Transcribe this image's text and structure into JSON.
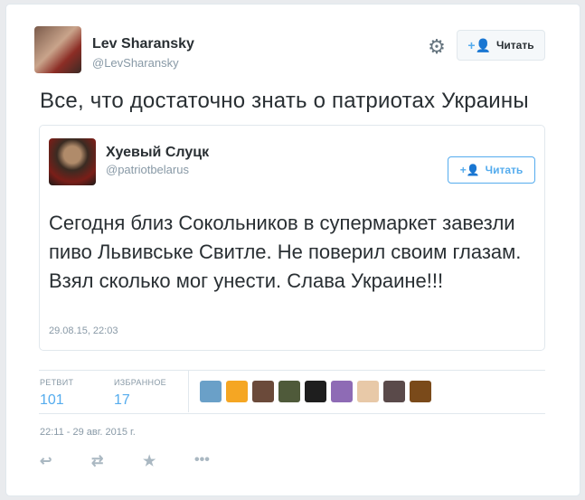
{
  "author": {
    "name": "Lev Sharansky",
    "handle": "@LevSharansky"
  },
  "follow_label": "Читать",
  "tweet_text": "Все, что достаточно знать о патриотах Украины",
  "quoted": {
    "name": "Хуевый Слуцк",
    "handle": "@patriotbelarus",
    "follow_label": "Читать",
    "text": "Сегодня близ Сокольников в супермаркет завезли пиво Львивське Свитле. Не поверил своим глазам. Взял сколько мог унести. Слава Украине!!!",
    "timestamp": "29.08.15, 22:03"
  },
  "stats": {
    "retweets_label": "РЕТВИТ",
    "retweets": "101",
    "favorites_label": "ИЗБРАННОЕ",
    "favorites": "17"
  },
  "favoriters": [
    {
      "color": "#6aa0c8"
    },
    {
      "color": "#f5a623"
    },
    {
      "color": "#6b4a3a"
    },
    {
      "color": "#4f5a3a"
    },
    {
      "color": "#1e1e1e"
    },
    {
      "color": "#8e6bb5"
    },
    {
      "color": "#e8c9a8"
    },
    {
      "color": "#5a4a4a"
    },
    {
      "color": "#7a4a1a"
    }
  ],
  "timestamp": "22:11 - 29 авг. 2015 г.",
  "actions": [
    {
      "icon": "reply-icon",
      "glyph": "↩"
    },
    {
      "icon": "retweet-icon",
      "glyph": "⇄"
    },
    {
      "icon": "favorite-icon",
      "glyph": "★"
    },
    {
      "icon": "more-icon",
      "glyph": "•••"
    }
  ]
}
